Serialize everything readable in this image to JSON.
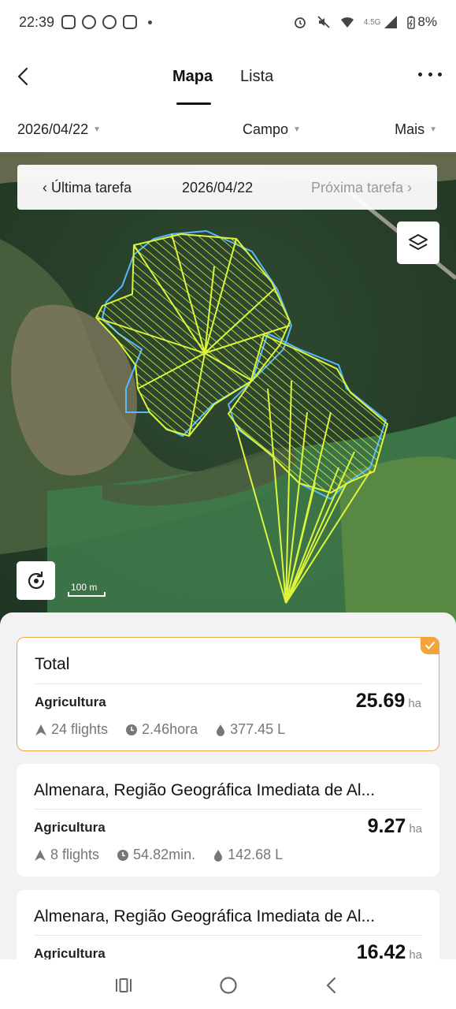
{
  "status_bar": {
    "time": "22:39",
    "network": "4.5G",
    "battery": "8%",
    "icons": [
      "instagram-icon",
      "whatsapp-icon",
      "facebook-icon",
      "screenshot-icon",
      "alarm-icon",
      "mute-icon",
      "wifi-icon",
      "signal-icon",
      "battery-icon"
    ]
  },
  "header": {
    "tabs": [
      "Mapa",
      "Lista"
    ],
    "active_tab": "Mapa"
  },
  "filters": {
    "date": "2026/04/22",
    "field": "Campo",
    "more": "Mais"
  },
  "map": {
    "prev_task": "Última tarefa",
    "current_date": "2026/04/22",
    "next_task": "Próxima tarefa",
    "scale_label": "100 m",
    "colors": {
      "flight_path": "#d8f23a",
      "boundary": "#56b8ff"
    }
  },
  "summary_cards": [
    {
      "title": "Total",
      "type": "Agricultura",
      "area": "25.69",
      "area_unit": "ha",
      "flights": "24 flights",
      "duration": "2.46hora",
      "volume": "377.45 L",
      "selected": true
    },
    {
      "title": "Almenara, Região Geográfica Imediata de Al...",
      "type": "Agricultura",
      "area": "9.27",
      "area_unit": "ha",
      "flights": "8 flights",
      "duration": "54.82min.",
      "volume": "142.68 L",
      "selected": false
    },
    {
      "title": "Almenara, Região Geográfica Imediata de Al...",
      "type": "Agricultura",
      "area": "16.42",
      "area_unit": "ha",
      "selected": false
    }
  ],
  "accent_color": "#f3a53d"
}
